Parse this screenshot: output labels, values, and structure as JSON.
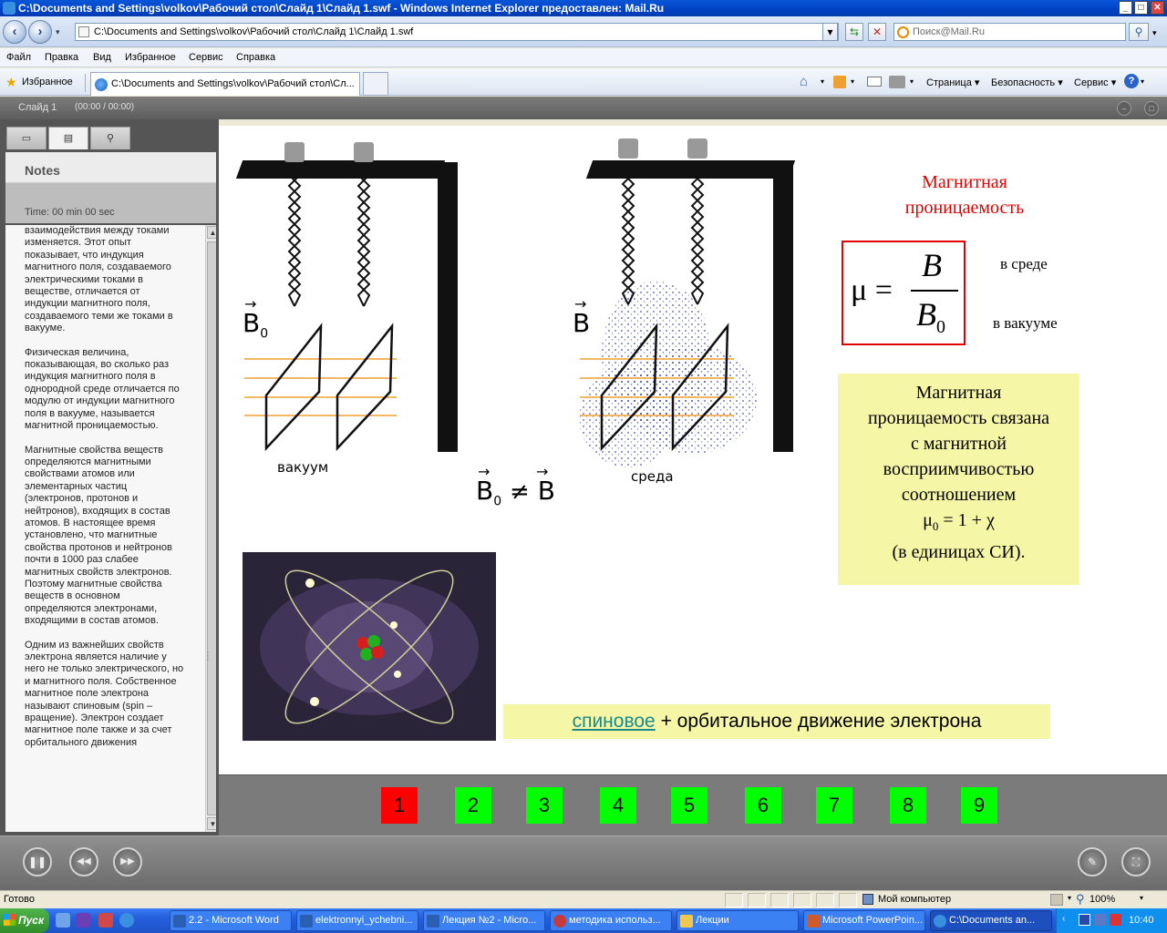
{
  "window": {
    "title": "C:\\Documents and Settings\\volkov\\Рабочий стол\\Слайд 1\\Слайд 1.swf - Windows Internet Explorer предоставлен: Mail.Ru",
    "minimize": "_",
    "maximize": "□",
    "close": "✕"
  },
  "address": {
    "url": "C:\\Documents and Settings\\volkov\\Рабочий стол\\Слайд 1\\Слайд 1.swf",
    "search_placeholder": "Поиск@Mail.Ru"
  },
  "menu": [
    "Файл",
    "Правка",
    "Вид",
    "Избранное",
    "Сервис",
    "Справка"
  ],
  "favorites": {
    "label": "Избранное",
    "tab_title": "C:\\Documents and Settings\\volkov\\Рабочий стол\\Сл..."
  },
  "commandbar": [
    "Страница ▾",
    "Безопасность ▾",
    "Сервис ▾"
  ],
  "player": {
    "slide_title": "Слайд 1",
    "slide_time": "(00:00 / 00:00)",
    "notes_label": "Notes",
    "time_label": "Time: 00 min 00 sec",
    "notes": [
      "взаимодействия между токами изменяется. Этот опыт показывает, что индукция магнитного поля, создаваемого электрическими токами в веществе, отличается от индукции магнитного поля, создаваемого теми же токами в вакууме.",
      "Физическая величина, показывающая, во сколько раз индукция   магнитного поля в однородной среде отличается по модулю от индукции  магнитного поля в вакууме, называется магнитной проницаемостью.",
      "Магнитные свойства веществ определяются магнитными свойствами атомов или элементарных частиц (электронов, протонов и нейтронов), входящих в состав атомов. В настоящее время установлено, что магнитные свойства протонов и нейтронов почти в 1000 раз слабее магнитных свойств электронов. Поэтому магнитные свойства веществ в основном определяются электронами, входящими в состав атомов.",
      "Одним из важнейших свойств электрона является наличие у него не только электрического, но и магнитного поля. Собственное магнитное поле электрона называют спиновым (spin – вращение). Электрон создает магнитное поле также и за счет орбитального движения"
    ]
  },
  "slide": {
    "label_vacuum": "вакуум",
    "label_medium": "среда",
    "title_line1": "Магнитная",
    "title_line2": "проницаемость",
    "formula_mu": "μ =",
    "formula_num": "B",
    "formula_den": "B",
    "formula_sub": "0",
    "in_medium": "в среде",
    "in_vacuum": "в вакууме",
    "b_vacuum": "B",
    "b_vacuum_sub": "0",
    "b_medium": "B",
    "neq_b0": "B",
    "neq_sub": "0",
    "neq_sign": "≠",
    "neq_b": "B",
    "yellow_lines": [
      "Магнитная",
      "проницаемость связана",
      "с магнитной",
      "восприимчивостью",
      "соотношением"
    ],
    "yellow_formula_mu": "μ",
    "yellow_formula_sub": "0",
    "yellow_formula_rest": " = 1 + χ",
    "yellow_last": "(в единицах СИ).",
    "spin_link": "спиновое",
    "spin_rest": " + орбитальное движение электрона"
  },
  "nav_numbers": [
    "1",
    "2",
    "3",
    "4",
    "5",
    "6",
    "7",
    "8",
    "9"
  ],
  "nav_colors": {
    "active": "#ff0000",
    "inactive": "#00ff00"
  },
  "status": {
    "text": "Готово",
    "zone": "Мой компьютер",
    "zoom": "100%"
  },
  "taskbar": {
    "start": "Пуск",
    "items": [
      "2.2 - Microsoft Word",
      "elektronnyi_ychebni...",
      "Лекция №2 - Micro...",
      "методика использ...",
      "Лекции",
      "Microsoft PowerPoin...",
      "C:\\Documents an..."
    ],
    "clock": "10:40"
  }
}
